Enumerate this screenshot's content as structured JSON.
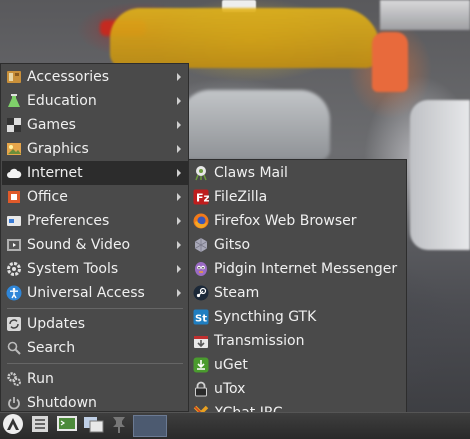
{
  "main_menu": {
    "items": [
      {
        "label": "Accessories",
        "icon": "accessories-icon",
        "submenu": true
      },
      {
        "label": "Education",
        "icon": "education-icon",
        "submenu": true
      },
      {
        "label": "Games",
        "icon": "games-icon",
        "submenu": true
      },
      {
        "label": "Graphics",
        "icon": "graphics-icon",
        "submenu": true
      },
      {
        "label": "Internet",
        "icon": "internet-cloud-icon",
        "submenu": true,
        "active": true
      },
      {
        "label": "Office",
        "icon": "office-icon",
        "submenu": true
      },
      {
        "label": "Preferences",
        "icon": "preferences-icon",
        "submenu": true
      },
      {
        "label": "Sound & Video",
        "icon": "sound-video-icon",
        "submenu": true
      },
      {
        "label": "System Tools",
        "icon": "gear-icon",
        "submenu": true
      },
      {
        "label": "Universal Access",
        "icon": "accessibility-icon",
        "submenu": true
      }
    ],
    "actions": [
      {
        "label": "Updates",
        "icon": "updates-icon"
      },
      {
        "label": "Search",
        "icon": "search-icon"
      }
    ],
    "session": [
      {
        "label": "Run",
        "icon": "run-icon"
      },
      {
        "label": "Shutdown",
        "icon": "power-icon"
      }
    ]
  },
  "internet_submenu": {
    "items": [
      {
        "label": "Claws Mail",
        "icon": "claws-mail-icon"
      },
      {
        "label": "FileZilla",
        "icon": "filezilla-icon"
      },
      {
        "label": "Firefox Web Browser",
        "icon": "firefox-icon"
      },
      {
        "label": "Gitso",
        "icon": "gitso-icon"
      },
      {
        "label": "Pidgin Internet Messenger",
        "icon": "pidgin-icon"
      },
      {
        "label": "Steam",
        "icon": "steam-icon"
      },
      {
        "label": "Syncthing GTK",
        "icon": "syncthing-icon"
      },
      {
        "label": "Transmission",
        "icon": "transmission-icon"
      },
      {
        "label": "uGet",
        "icon": "uget-icon"
      },
      {
        "label": "uTox",
        "icon": "utox-icon"
      },
      {
        "label": "XChat IRC",
        "icon": "xchat-icon"
      }
    ]
  },
  "taskbar": {
    "items": [
      "start-menu-icon",
      "file-manager-icon",
      "terminal-icon",
      "show-desktop-icon",
      "pin-icon"
    ]
  },
  "colors": {
    "menu_bg": "#4a4a4a",
    "menu_active": "#2c2c2c",
    "text": "#f0f0f0"
  }
}
